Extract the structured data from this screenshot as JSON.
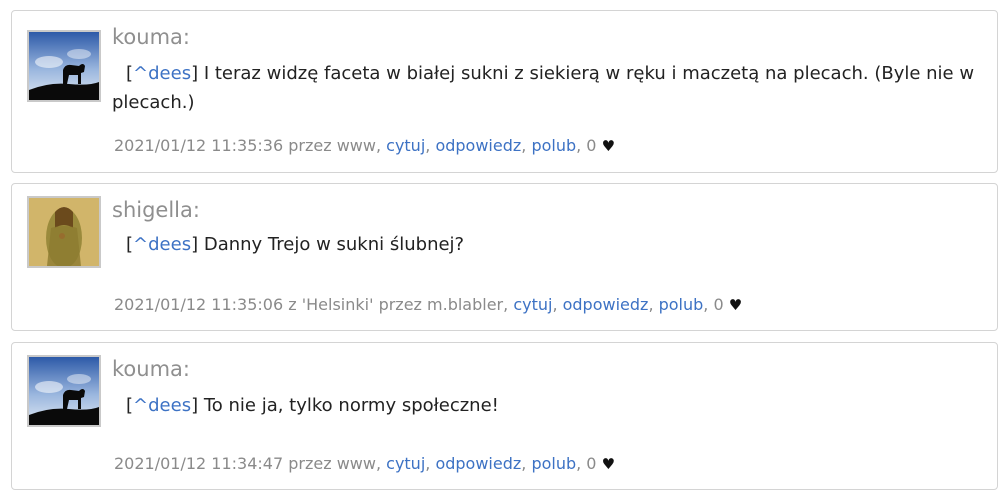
{
  "comments": [
    {
      "author": "kouma:",
      "avatar": "silhouette-dog-avatar",
      "reply_to": "^dees",
      "text": " I teraz widzę faceta w białej sukni z siekierą w ręku i maczetą na plecach. (Byle nie w plecach.)",
      "meta_prefix": "2021/01/12 11:35:36 przez www, ",
      "cytuj": "cytuj",
      "odpowiedz": "odpowiedz",
      "polub": "polub",
      "likes": "0"
    },
    {
      "author": "shigella:",
      "avatar": "painting-woman-avatar",
      "reply_to": "^dees",
      "text": " Danny Trejo w sukni ślubnej?",
      "meta_prefix": "2021/01/12 11:35:06 z 'Helsinki' przez m.blabler, ",
      "cytuj": "cytuj",
      "odpowiedz": "odpowiedz",
      "polub": "polub",
      "likes": "0"
    },
    {
      "author": "kouma:",
      "avatar": "silhouette-dog-avatar",
      "reply_to": "^dees",
      "text": " To nie ja, tylko normy społeczne!",
      "meta_prefix": "2021/01/12 11:34:47 przez www, ",
      "cytuj": "cytuj",
      "odpowiedz": "odpowiedz",
      "polub": "polub",
      "likes": "0"
    }
  ],
  "colors": {
    "link": "#3d72c4",
    "meta": "#8a8a8a",
    "author": "#8f8f8f",
    "border": "#d4d4d4"
  }
}
